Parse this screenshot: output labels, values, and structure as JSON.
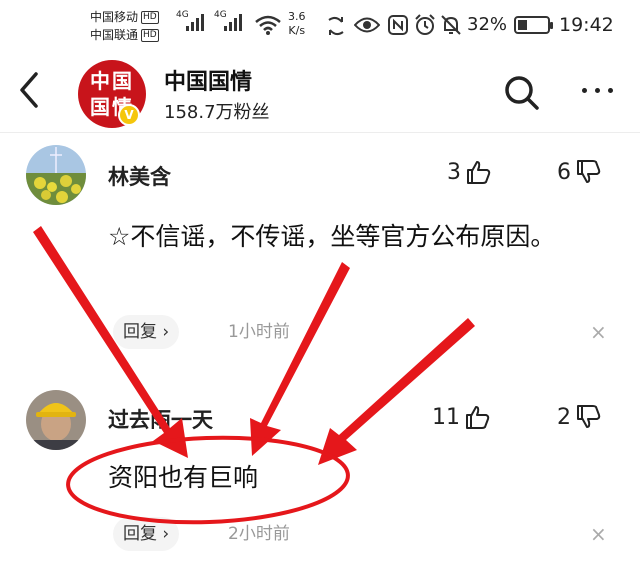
{
  "status_bar": {
    "carrier1": "中国移动",
    "carrier2": "中国联通",
    "hd": "HD",
    "net1": "4G",
    "net2": "4G",
    "speed_value": "3.6",
    "speed_unit": "K/s",
    "battery": "32%",
    "battery_level": 0.32,
    "time": "19:42"
  },
  "header": {
    "account_name": "中国国情",
    "fans": "158.7万粉丝",
    "logo_text": "中国国情",
    "verified": "V"
  },
  "comments": [
    {
      "user": "林美含",
      "likes": "3",
      "dislikes": "6",
      "text": "☆不信谣，不传谣，坐等官方公布原因。",
      "reply": "回复",
      "time": "1小时前",
      "close": "×"
    },
    {
      "user": "过去雨一天",
      "likes": "11",
      "dislikes": "2",
      "text": "资阳也有巨响",
      "reply": "回复",
      "time": "2小时前",
      "close": "×"
    }
  ],
  "colors": {
    "annotation_red": "#e5171b",
    "logo_red": "#c8141b",
    "badge_yellow": "#f5c60c"
  }
}
